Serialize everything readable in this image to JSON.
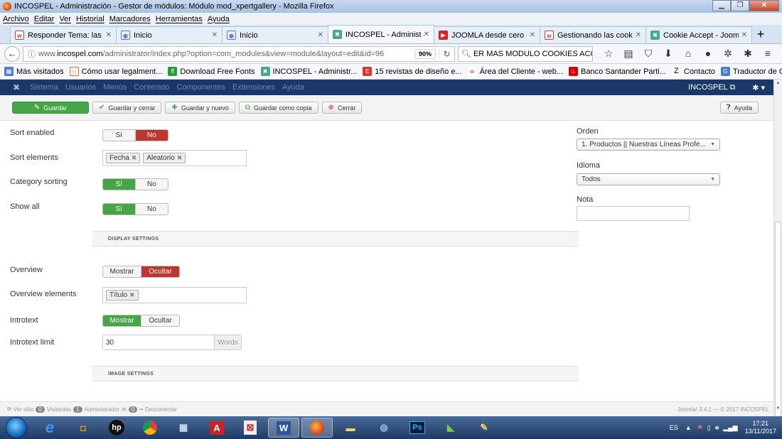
{
  "window": {
    "title": "INCOSPEL - Administración - Gestor de módulos: Módulo mod_xpertgallery - Mozilla Firefox"
  },
  "menubar": [
    "Archivo",
    "Editar",
    "Ver",
    "Historial",
    "Marcadores",
    "Herramientas",
    "Ayuda"
  ],
  "tabs": [
    {
      "label": "Responder Tema: las im",
      "icon": "w-icon"
    },
    {
      "label": "Inicio",
      "icon": "joomla-icon"
    },
    {
      "label": "Inicio",
      "icon": "joomla-icon"
    },
    {
      "label": "INCOSPEL - Administrac",
      "icon": "incospel-icon"
    },
    {
      "label": "JOOMLA desde cero - Tr",
      "icon": "youtube-icon"
    },
    {
      "label": "Gestionando las cookies",
      "icon": "w-icon"
    },
    {
      "label": "Cookie Accept - Joomla",
      "icon": "incospel-icon"
    }
  ],
  "nav": {
    "url_prefix": "www.",
    "url_domain": "incospel.com",
    "url_path": "/administrator/index.php?option=com_modules&view=module&layout=edit&id=96",
    "zoom": "90%",
    "search": "ER MAS MODULO COOKIES ACCEPT"
  },
  "bookmarks": [
    "Más visitados",
    "Cómo usar legalment...",
    "Download Free Fonts",
    "INCOSPEL - Administr...",
    "15 revistas de diseño e...",
    "Área del Cliente - web...",
    "Banco Santander Parti...",
    "Contacto",
    "Traductor de Google"
  ],
  "joomla_menu": [
    "Sistema",
    "Usuarios",
    "Menús",
    "Contenido",
    "Componentes",
    "Extensiones",
    "Ayuda"
  ],
  "site_name": "INCOSPEL",
  "toolbar": {
    "save": "Guardar",
    "save_close": "Guardar y cerrar",
    "save_new": "Guardar y nuevo",
    "save_copy": "Guardar como copia",
    "close": "Cerrar",
    "help": "Ayuda"
  },
  "form": {
    "sort_enabled": {
      "label": "Sort enabled",
      "yes": "Sí",
      "no": "No"
    },
    "sort_elements": {
      "label": "Sort elements",
      "tags": [
        "Fecha",
        "Aleatorio"
      ]
    },
    "category_sorting": {
      "label": "Category sorting",
      "yes": "Sí",
      "no": "No"
    },
    "show_all": {
      "label": "Show all",
      "yes": "Sí",
      "no": "No"
    },
    "display_settings": "DISPLAY SETTINGS",
    "overview": {
      "label": "Overview",
      "show": "Mostrar",
      "hide": "Ocultar"
    },
    "overview_elements": {
      "label": "Overview elements",
      "tags": [
        "Título"
      ]
    },
    "introtext": {
      "label": "Introtext",
      "show": "Mostrar",
      "hide": "Ocultar"
    },
    "introtext_limit": {
      "label": "Introtext limit",
      "value": "30",
      "unit": "Words"
    },
    "image_settings": "IMAGE SETTINGS"
  },
  "sidebar": {
    "order_label": "Orden",
    "order_value": "1. Productos || Nuestras Líneas Profe...",
    "language_label": "Idioma",
    "language_value": "Todos",
    "note_label": "Nota",
    "note_value": ""
  },
  "status": {
    "view_site": "Ver sitio",
    "visitors_count": "0",
    "visitors": "Visitantes",
    "admin_count": "1",
    "admin": "Administrador",
    "msg_count": "0",
    "logout": "Desconectar",
    "version": "Joomla! 3.4.1 — © 2017 INCOSPEL"
  },
  "taskbar": {
    "lang": "ES",
    "time": "17:21",
    "date": "13/11/2017"
  }
}
